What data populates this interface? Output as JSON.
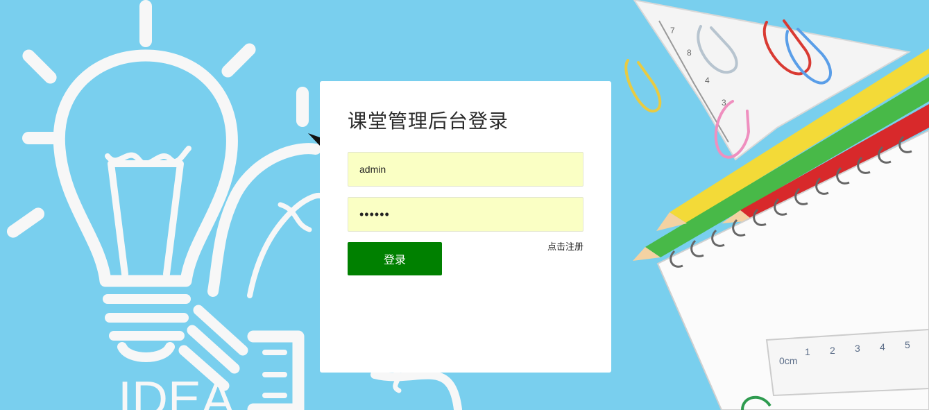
{
  "login": {
    "title": "课堂管理后台登录",
    "username_value": "admin",
    "password_value": "••••••",
    "login_button_label": "登录",
    "register_link_label": "点击注册"
  },
  "background": {
    "idea_text": "IDEA",
    "color": "#79cfee",
    "button_color": "#008000",
    "input_color": "#faffc4"
  }
}
